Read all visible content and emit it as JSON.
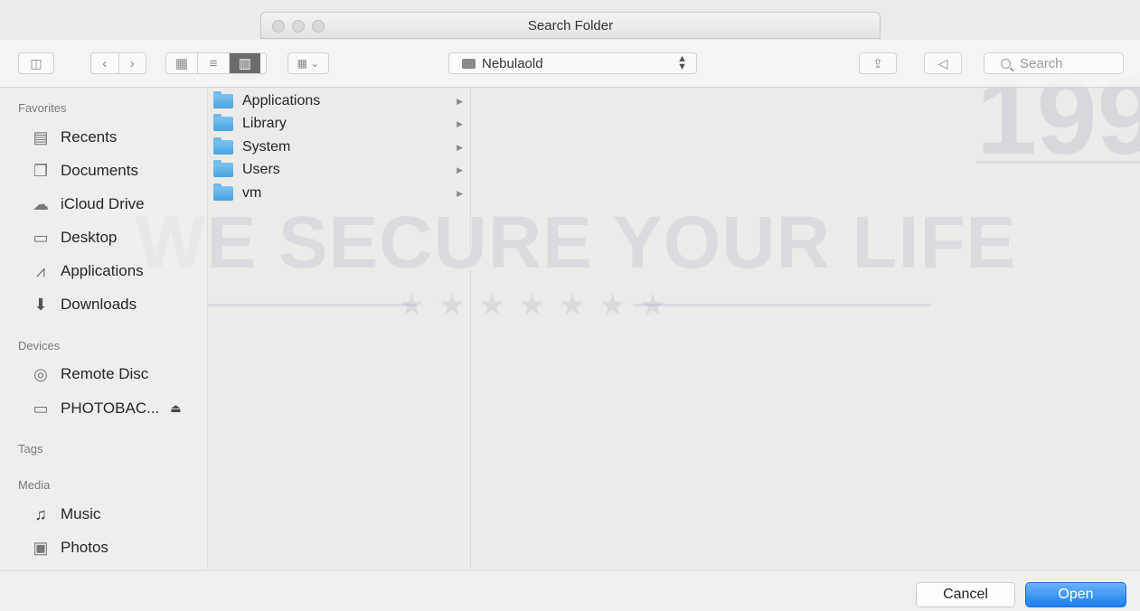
{
  "window": {
    "title": "Search Folder"
  },
  "toolbar": {
    "location": "Nebulaold",
    "search_placeholder": "Search"
  },
  "sidebar": {
    "sections": {
      "favorites": "Favorites",
      "devices": "Devices",
      "tags": "Tags",
      "media": "Media"
    },
    "favorites": [
      {
        "label": "Recents",
        "icon": "recents-icon"
      },
      {
        "label": "Documents",
        "icon": "documents-icon"
      },
      {
        "label": "iCloud Drive",
        "icon": "cloud-icon"
      },
      {
        "label": "Desktop",
        "icon": "desktop-icon"
      },
      {
        "label": "Applications",
        "icon": "applications-icon"
      },
      {
        "label": "Downloads",
        "icon": "downloads-icon"
      }
    ],
    "devices": [
      {
        "label": "Remote Disc",
        "icon": "disc-icon"
      },
      {
        "label": "PHOTOBAC...",
        "icon": "drive-icon"
      }
    ],
    "media": [
      {
        "label": "Music",
        "icon": "music-icon"
      },
      {
        "label": "Photos",
        "icon": "photos-icon"
      }
    ]
  },
  "column1": {
    "items": [
      {
        "label": "Applications"
      },
      {
        "label": "Library"
      },
      {
        "label": "System"
      },
      {
        "label": "Users"
      },
      {
        "label": "vm"
      }
    ]
  },
  "buttons": {
    "cancel": "Cancel",
    "open": "Open"
  },
  "watermark": {
    "text": "WE SECURE YOUR LIFE",
    "year": "199"
  },
  "colors": {
    "accent": "#1c7ef2",
    "folder": "#4aa3e0"
  }
}
